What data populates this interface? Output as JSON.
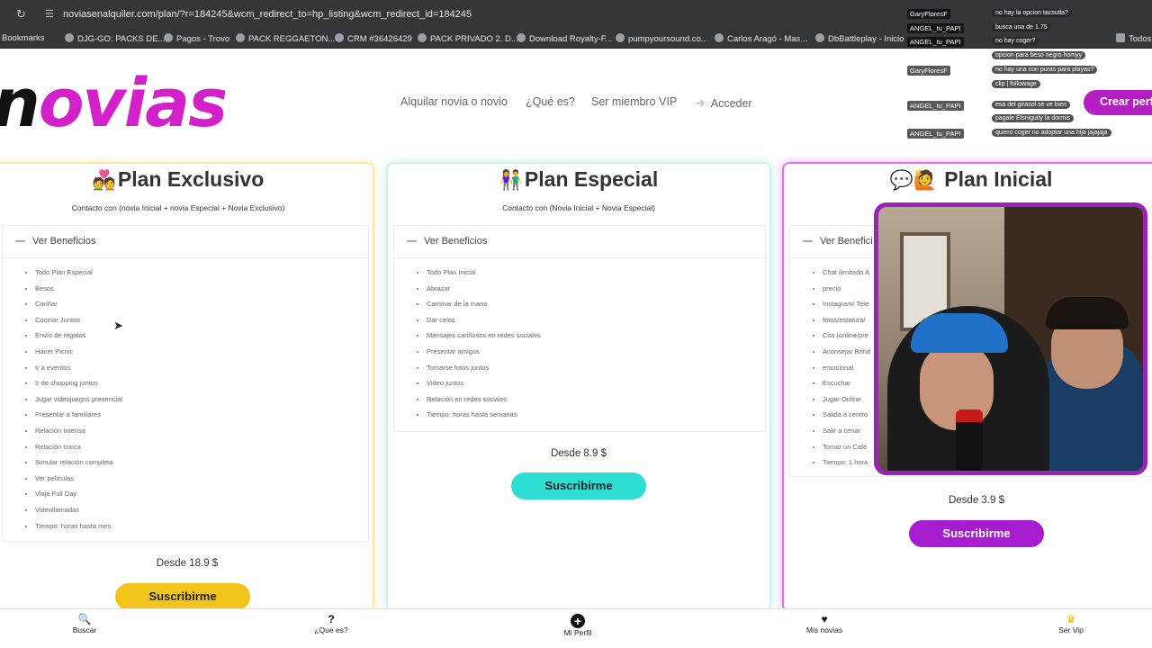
{
  "browser": {
    "url": "noviasenalquiler.com/plan/?r=184245&wcm_redirect_to=hp_listing&wcm_redirect_id=184245",
    "bookmarks": [
      {
        "label": "Bookmarks",
        "icon": "bookmark-icon"
      },
      {
        "label": "DJG-GO: PACKS DE...",
        "icon": "site-icon"
      },
      {
        "label": "Pagos - Trovo",
        "icon": "site-icon"
      },
      {
        "label": "PACK REGGAETON...",
        "icon": "site-icon"
      },
      {
        "label": "CRM #36426429",
        "icon": "site-icon"
      },
      {
        "label": "PACK PRIVADO 2. D...",
        "icon": "site-icon"
      },
      {
        "label": "Download Royalty-F...",
        "icon": "site-icon"
      },
      {
        "label": "pumpyoursound.co...",
        "icon": "site-icon"
      },
      {
        "label": "Carlos Aragó - Mas...",
        "icon": "site-icon"
      },
      {
        "label": "DbBattleplay - Inicio",
        "icon": "site-icon"
      },
      {
        "label": "Todos",
        "icon": "folder-icon"
      }
    ]
  },
  "chat": [
    {
      "user": "GaryFloresF",
      "msg": "no hay la opcion tacsutla?"
    },
    {
      "user": "ANGEL_tu_PAPI",
      "msg": "busca una de 1.75"
    },
    {
      "user": "ANGEL_tu_PAPI",
      "msg": "no hay coger?"
    },
    {
      "user": "",
      "msg": "opcion para beso negro homyy"
    },
    {
      "user": "GaryFloresF",
      "msg": "no hay una con puras para playas?"
    },
    {
      "user": "",
      "msg": "clip | followage"
    },
    {
      "user": "ANGEL_tu_PAPI",
      "msg": "esa del girasol se ve bien"
    },
    {
      "user": "",
      "msg": "pagale Elsniguity la dormis"
    },
    {
      "user": "ANGEL_tu_PAPI",
      "msg": "quiero coger no adoptar una hija jajajaja"
    }
  ],
  "site": {
    "logo_first": "n",
    "logo_rest": "ovias",
    "nav": {
      "alquilar": "Alquilar novia o novio",
      "que_es": "¿Qué es?",
      "vip": "Ser miembro VIP",
      "acceder": "Acceder",
      "crear_perfil": "Crear perfil"
    }
  },
  "plans": {
    "exclusivo": {
      "emoji": "💑",
      "title": "Plan Exclusivo",
      "subtitle": "Contacto con (novia Inicial + novia Especial + Novia Exclusivo)",
      "benefits_label": "Ver Beneficios",
      "benefits": [
        "Todo Plan Especial",
        "Besos",
        "Cariñar",
        "Cocinar Juntos",
        "Envío de regalos",
        "Hacer Picnic",
        "Ir a eventos",
        "Ir de shopping juntos",
        "Jugar videojuegos presencial",
        "Presentar a familiares",
        "Relación Intensa",
        "Relación toxica",
        "Simular relación completa",
        "Ver películas",
        "Viaje Full Day",
        "Videollamadas",
        "Tiempo: horas hasta mes"
      ],
      "price": "Desde 18.9 $",
      "button": "Suscribirme",
      "color": "#f3c51c"
    },
    "especial": {
      "emoji": "👫",
      "title": "Plan Especial",
      "subtitle": "Contacto con (Novia Inicial + Novia Especial)",
      "benefits_label": "Ver Beneficios",
      "benefits": [
        "Todo Plan Inicial",
        "Abrazar",
        "Caminar de la mano",
        "Dar celos",
        "Mensajes cariñosos en redes sociales",
        "Presentar amigos",
        "Tomarse fotos juntos",
        "Video juntos",
        "Relación en redes sociales",
        "Tiempo: horas hasta semanas"
      ],
      "price": "Desde 8.9 $",
      "button": "Suscribirme",
      "color": "#2fded3"
    },
    "inicial": {
      "emoji": "💬🙋",
      "title": "Plan Inicial",
      "benefits_label": "Ver Benefici",
      "benefits": [
        "Chat ilimitado A",
        "precio",
        "Instagram/ Tele",
        "fotos/estatura/",
        "Cita (online/pre",
        "Aconsejar Brind",
        "emocional",
        "Escuchar",
        "Jugar Online",
        "Salida a centro",
        "Salir a cenar",
        "Tomar un Café",
        "Tiempo: 1 hora"
      ],
      "price": "Desde 3.9 $",
      "button": "Suscribirme",
      "color": "#a61ccf"
    }
  },
  "bottom_nav": {
    "buscar": "Buscar",
    "que_es": "¿Que es?",
    "mi_perfil": "Mi Perfil",
    "mis_novias": "Mis novias",
    "ser_vip": "Ser Vip"
  }
}
